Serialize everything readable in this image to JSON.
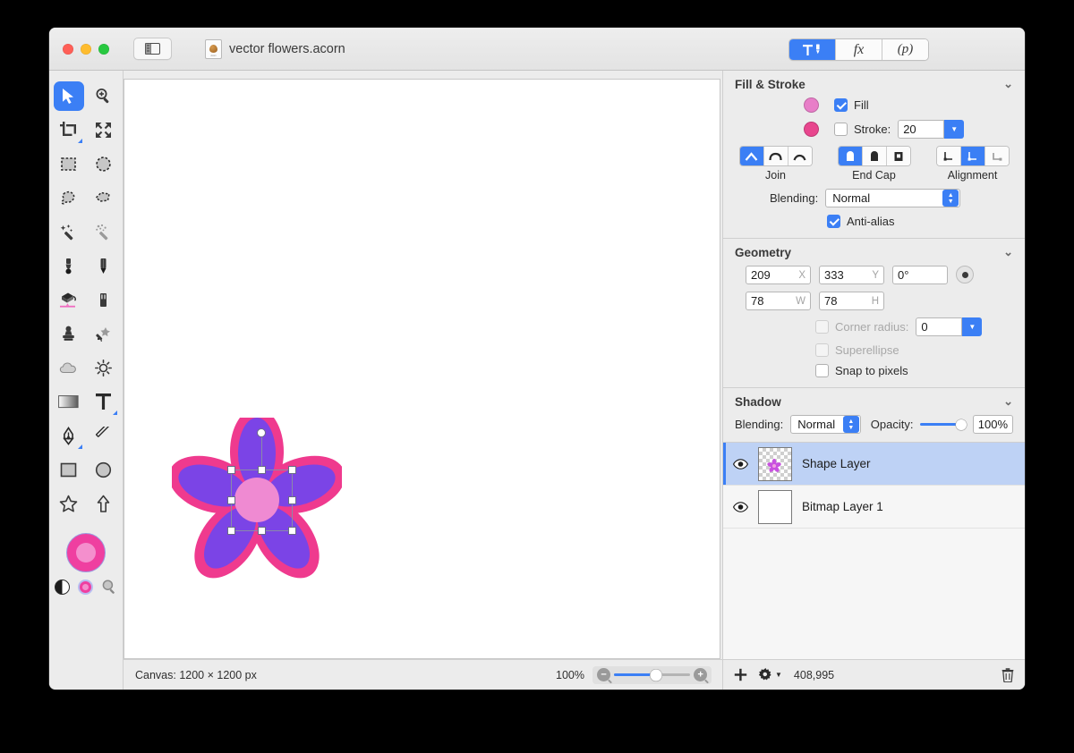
{
  "window": {
    "title": "vector flowers.acorn",
    "traffic_lights": [
      "close",
      "minimize",
      "zoom"
    ],
    "sidebar_toggle_icon": "sidebar-icon",
    "doc_icon": "acorn-document-icon",
    "doc_icon_label": "Acorn"
  },
  "toolbar_segments": [
    {
      "name": "tools-inspector",
      "icon": "hammer-brush-icon",
      "label": "",
      "active": true
    },
    {
      "name": "filters-inspector",
      "icon": "fx-icon",
      "label": "fx",
      "active": false
    },
    {
      "name": "palette-inspector",
      "icon": "p-icon",
      "label": "(p)",
      "active": false
    }
  ],
  "tools": [
    {
      "name": "move-selection-tool",
      "icon": "arrow-cursor-icon",
      "selected": true
    },
    {
      "name": "zoom-tool",
      "icon": "magnifier-plus-icon",
      "selected": false
    },
    {
      "name": "crop-tool",
      "icon": "crop-icon",
      "selected": false,
      "badge": true
    },
    {
      "name": "transform-tool",
      "icon": "arrows-expand-icon",
      "selected": false
    },
    {
      "name": "rectangular-marquee-tool",
      "icon": "dashed-rectangle-icon",
      "selected": false
    },
    {
      "name": "elliptical-marquee-tool",
      "icon": "dashed-ellipse-icon",
      "selected": false
    },
    {
      "name": "lasso-tool",
      "icon": "lasso-icon",
      "selected": false
    },
    {
      "name": "polygon-lasso-tool",
      "icon": "polygon-lasso-icon",
      "selected": false
    },
    {
      "name": "magic-wand-tool",
      "icon": "magic-wand-icon",
      "selected": false
    },
    {
      "name": "instant-alpha-tool",
      "icon": "magic-wand-dotted-icon",
      "selected": false
    },
    {
      "name": "brush-tool",
      "icon": "brush-icon",
      "selected": false
    },
    {
      "name": "pencil-tool",
      "icon": "pencil-icon",
      "selected": false
    },
    {
      "name": "paint-bucket-tool",
      "icon": "paint-bucket-icon",
      "selected": false
    },
    {
      "name": "eraser-tool",
      "icon": "eraser-icon",
      "selected": false
    },
    {
      "name": "clone-stamp-tool",
      "icon": "stamp-icon",
      "selected": false
    },
    {
      "name": "smudge-tool",
      "icon": "smudge-sparkle-icon",
      "selected": false
    },
    {
      "name": "blur-tool",
      "icon": "cloud-icon",
      "selected": false
    },
    {
      "name": "dodge-tool",
      "icon": "sun-icon",
      "selected": false
    },
    {
      "name": "gradient-tool",
      "icon": "gradient-icon",
      "selected": false
    },
    {
      "name": "text-tool",
      "icon": "text-t-icon",
      "selected": false,
      "badge": true
    },
    {
      "name": "pen-tool",
      "icon": "pen-nib-icon",
      "selected": false,
      "badge": true
    },
    {
      "name": "line-tool",
      "icon": "line-icon",
      "selected": false
    },
    {
      "name": "rectangle-tool",
      "icon": "rectangle-icon",
      "selected": false
    },
    {
      "name": "ellipse-tool",
      "icon": "ellipse-icon",
      "selected": false
    },
    {
      "name": "star-tool",
      "icon": "star-icon",
      "selected": false
    },
    {
      "name": "arrow-shape-tool",
      "icon": "arrow-up-icon",
      "selected": false
    }
  ],
  "color_well": {
    "name": "foreground-color-well",
    "outer": "#ef3fa0",
    "inner": "#f48fcd",
    "contrast_icon": "half-circle-icon",
    "mini_color_icon": "small-color-circle-icon",
    "picker_icon": "magnifier-icon"
  },
  "canvas": {
    "artwork_name": "flower-shape",
    "petal_color": "#7b44e6",
    "outline_color": "#ef3a8e",
    "center_color": "#ef8ad2",
    "selection_handles": 8,
    "rotation_handle": true
  },
  "fill_stroke": {
    "title": "Fill & Stroke",
    "collapse_icon": "chevron-down-icon",
    "fill_label": "Fill",
    "fill_checked": true,
    "fill_color": "#e87ec8",
    "stroke_label": "Stroke:",
    "stroke_checked": false,
    "stroke_color": "#e8468e",
    "stroke_width": "20",
    "join_label": "Join",
    "join_options": [
      "miter-join-icon",
      "round-join-icon",
      "bevel-join-icon"
    ],
    "join_selected": 0,
    "endcap_label": "End Cap",
    "endcap_options": [
      "butt-cap-icon",
      "round-cap-icon",
      "square-cap-icon"
    ],
    "endcap_selected": 0,
    "alignment_label": "Alignment",
    "alignment_options": [
      "align-inside-icon",
      "align-center-icon",
      "align-outside-icon"
    ],
    "alignment_selected": 1,
    "blending_label": "Blending:",
    "blending_value": "Normal",
    "antialias_label": "Anti-alias",
    "antialias_checked": true
  },
  "geometry": {
    "title": "Geometry",
    "collapse_icon": "chevron-down-icon",
    "x_value": "209",
    "x_unit": "X",
    "y_value": "333",
    "y_unit": "Y",
    "rotation_value": "0°",
    "rotation_dot_icon": "rotation-dot-icon",
    "w_value": "78",
    "w_unit": "W",
    "h_value": "78",
    "h_unit": "H",
    "corner_radius_label": "Corner radius:",
    "corner_radius_value": "0",
    "corner_radius_checked": false,
    "corner_radius_disabled": true,
    "superellipse_label": "Superellipse",
    "superellipse_checked": false,
    "superellipse_disabled": true,
    "snap_label": "Snap to pixels",
    "snap_checked": false
  },
  "shadow": {
    "title": "Shadow",
    "collapse_icon": "chevron-down-icon",
    "blending_label": "Blending:",
    "blending_value": "Normal",
    "opacity_label": "Opacity:",
    "opacity_value": "100%",
    "opacity_percent": 100
  },
  "layers": [
    {
      "name": "Shape Layer",
      "selected": true,
      "visible": true,
      "thumb": "checker-flower"
    },
    {
      "name": "Bitmap Layer 1",
      "selected": false,
      "visible": true,
      "thumb": "white"
    }
  ],
  "layers_bar": {
    "add_icon": "plus-icon",
    "settings_icon": "gear-icon",
    "memory_text": "408,995",
    "trash_icon": "trash-icon"
  },
  "statusbar": {
    "canvas_text": "Canvas: 1200 × 1200 px",
    "zoom_text": "100%",
    "zoom_percent": 55,
    "zoom_out_icon": "magnifier-minus-icon",
    "zoom_in_icon": "magnifier-plus-icon"
  }
}
